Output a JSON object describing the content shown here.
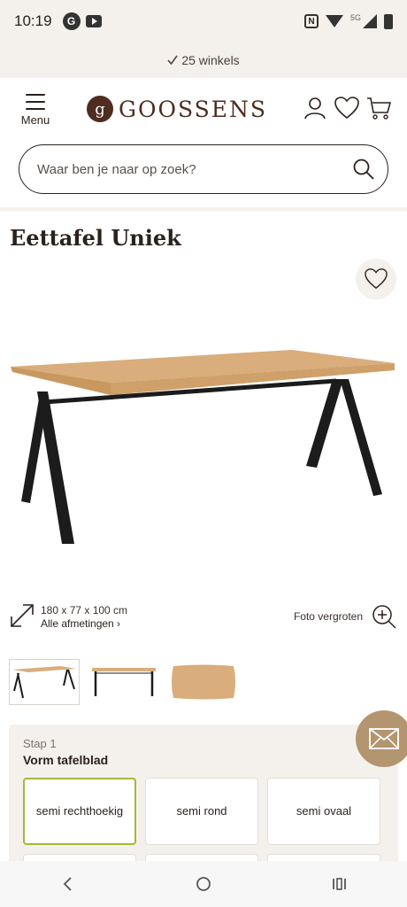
{
  "status_bar": {
    "time": "10:19",
    "app_badge": "G",
    "network": "5G"
  },
  "promo": {
    "text": "25 winkels"
  },
  "header": {
    "menu_label": "Menu",
    "logo_mark": "g",
    "logo_text": "GOOSSENS",
    "icons": [
      "account-icon",
      "wishlist-icon",
      "cart-icon"
    ]
  },
  "search": {
    "placeholder": "Waar ben je naar op zoek?"
  },
  "product": {
    "title": "Eettafel Uniek",
    "dimensions": "180 x 77 x 100 cm",
    "all_dimensions_link": "Alle afmetingen ›",
    "zoom_label": "Foto vergroten"
  },
  "configurator": {
    "step_label": "Stap 1",
    "step_title": "Vorm tafelblad",
    "options": [
      {
        "label": "semi rechthoekig",
        "selected": true
      },
      {
        "label": "semi rond",
        "selected": false
      },
      {
        "label": "semi ovaal",
        "selected": false
      }
    ]
  },
  "colors": {
    "brand": "#4e2c1f",
    "accent_selected": "#a7b63a",
    "panel_bg": "#f4f1ec",
    "fab": "#b39570",
    "oak": "#d9ad7c"
  }
}
